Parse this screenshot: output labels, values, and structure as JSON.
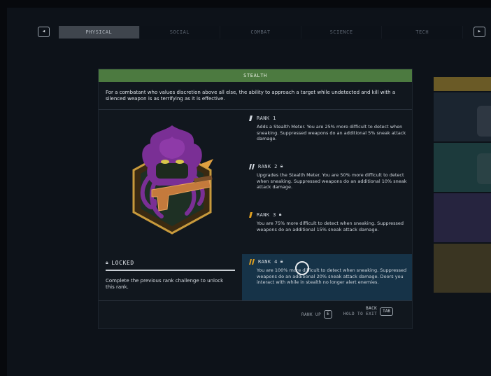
{
  "nav": {
    "prev_key": "◂",
    "next_key": "▸",
    "tabs": [
      {
        "label": "PHYSICAL",
        "active": true
      },
      {
        "label": "SOCIAL",
        "active": false
      },
      {
        "label": "COMBAT",
        "active": false
      },
      {
        "label": "SCIENCE",
        "active": false
      },
      {
        "label": "TECH",
        "active": false
      }
    ]
  },
  "skill": {
    "title": "STEALTH",
    "description": "For a combatant who values discretion above all else, the ability to approach a target while undetected and kill with a silenced weapon is as terrifying as it is effective.",
    "header_color": "#4c7a40",
    "emblem_icon": "stealth-hooded-figure-pistol-emblem"
  },
  "status": {
    "label": "LOCKED",
    "description": "Complete the previous rank challenge to unlock this rank."
  },
  "ranks": [
    {
      "label": "RANK 1",
      "locked": false,
      "text": "Adds a Stealth Meter. You are 25% more difficult to detect when sneaking. Suppressed weapons do an additional 5% sneak attack damage."
    },
    {
      "label": "RANK 2",
      "locked": true,
      "text": "Upgrades the Stealth Meter. You are 50% more difficult to detect when sneaking. Suppressed weapons do an additional 10% sneak attack damage."
    },
    {
      "label": "RANK 3",
      "locked": true,
      "text": "You are 75% more difficult to detect when sneaking. Suppressed weapons do an additional 15% sneak attack damage."
    },
    {
      "label": "RANK 4",
      "locked": true,
      "text": "You are 100% more difficult to detect when sneaking. Suppressed weapons do an additional 20% sneak attack damage. Doors you interact with while in stealth no longer alert enemies."
    }
  ],
  "footer": {
    "rank_up_label": "RANK UP",
    "rank_up_key": "E",
    "back_label": "BACK",
    "hold_label": "HOLD TO EXIT",
    "back_key": "TAB"
  },
  "colors": {
    "accent_green": "#4c7a40",
    "rank_marker": "#e0a020",
    "selected_row": "#163348"
  }
}
